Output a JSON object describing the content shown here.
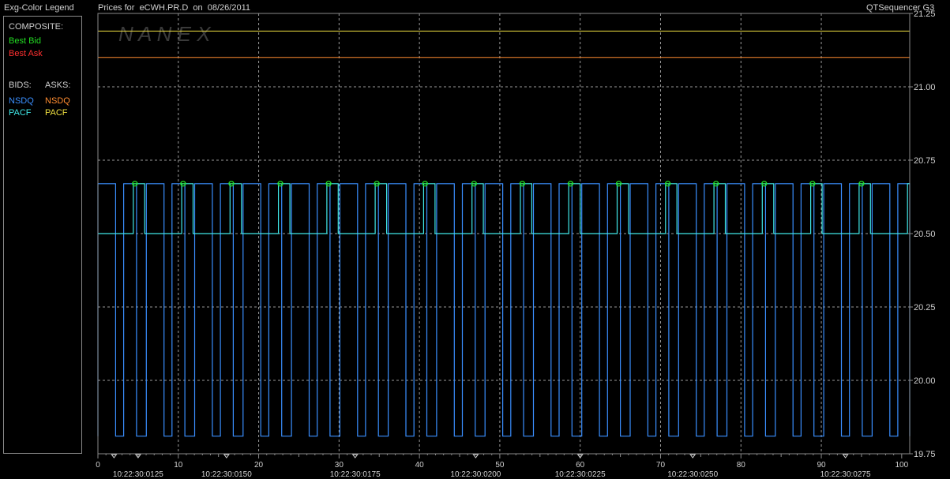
{
  "header": {
    "legend_title": "Exg-Color Legend",
    "chart_title": "Prices for  eCWH.PR.D  on  08/26/2011",
    "app_name": "QTSequencer G3"
  },
  "legend": {
    "composite_heading": "COMPOSITE:",
    "best_bid": "Best Bid",
    "best_ask": "Best Ask",
    "bids_heading": "BIDS:",
    "asks_heading": "ASKS:",
    "bid_items": [
      "NSDQ",
      "PACF"
    ],
    "ask_items": [
      "NSDQ",
      "PACF"
    ]
  },
  "colors": {
    "best_bid": "#22dd22",
    "best_ask": "#ff3030",
    "nsdq_bid": "#3a8fff",
    "pacf_bid": "#40e8e8",
    "nsdq_ask": "#ff8c30",
    "pacf_ask": "#f0e040",
    "grid": "#9a9a9a",
    "frame": "#8a8a8a",
    "text": "#d0d0d0"
  },
  "watermark": "N A N E X",
  "chart_data": {
    "type": "line",
    "title": "Prices for  eCWH.PR.D  on  08/26/2011",
    "xlim": [
      0,
      101
    ],
    "ylim": [
      19.75,
      21.25
    ],
    "x_ticks": [
      0,
      10,
      20,
      30,
      40,
      50,
      60,
      70,
      80,
      90,
      100
    ],
    "y_ticks": [
      19.75,
      20.0,
      20.25,
      20.5,
      20.75,
      21.0,
      21.25
    ],
    "y_tick_labels": [
      "19.75",
      "20.00",
      "20.25",
      "20.50",
      "20.75",
      "21.00",
      "21.25"
    ],
    "time_labels": [
      {
        "x": 5,
        "label": "10:22:30:0125"
      },
      {
        "x": 16,
        "label": "10:22:30:0150"
      },
      {
        "x": 32,
        "label": "10:22:30:0175"
      },
      {
        "x": 47,
        "label": "10:22:30:0200"
      },
      {
        "x": 60,
        "label": "10:22:30:0225"
      },
      {
        "x": 74,
        "label": "10:22:30:0250"
      },
      {
        "x": 93,
        "label": "10:22:30:0275"
      }
    ],
    "time_markers": [
      2,
      5,
      16,
      32,
      47,
      60,
      74,
      93
    ],
    "grid": true,
    "series": [
      {
        "name": "NSDQ",
        "side": "ask",
        "color": "#ff8c30",
        "level": 21.1
      },
      {
        "name": "PACF",
        "side": "ask",
        "color": "#f0e040",
        "level": 21.19
      },
      {
        "name": "NSDQ",
        "side": "bid",
        "color": "#3a8fff",
        "high": 20.67,
        "low": 19.81,
        "period_start": -0.2,
        "period": 6.02,
        "pattern": [
          [
            0,
            "low"
          ],
          [
            0.2,
            "high"
          ],
          [
            2.4,
            "low"
          ],
          [
            3.4,
            "high"
          ],
          [
            5.0,
            "low"
          ]
        ],
        "x_end": 101
      },
      {
        "name": "PACF",
        "side": "bid",
        "color": "#40e8e8",
        "high": 20.67,
        "low": 20.5,
        "period_start": -0.2,
        "period": 6.02,
        "pattern": [
          [
            0,
            "low"
          ],
          [
            4.6,
            "high"
          ]
        ],
        "x_end": 101
      }
    ],
    "best_bid_markers": {
      "level": 20.67,
      "x": [
        4.6,
        10.6,
        16.6,
        22.7,
        28.7,
        34.7,
        40.7,
        46.8,
        52.8,
        58.8,
        64.8,
        70.9,
        76.9,
        82.9,
        88.9,
        95.0
      ]
    }
  }
}
